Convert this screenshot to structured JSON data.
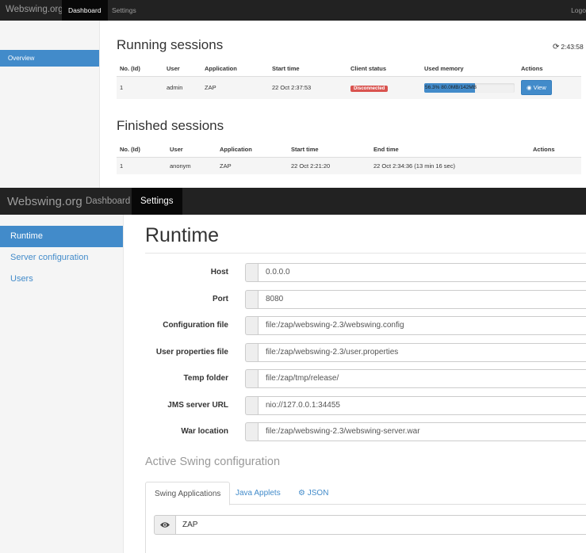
{
  "dashboard": {
    "brand": "Webswing.org",
    "nav": {
      "dashboard": "Dashboard",
      "settings": "Settings",
      "logout": "Logo"
    },
    "sidebar": {
      "overview": "Overview"
    },
    "clock": "2:43:58",
    "running": {
      "title": "Running sessions",
      "headers": [
        "No. (Id)",
        "User",
        "Application",
        "Start time",
        "Client status",
        "Used memory",
        "Actions"
      ],
      "rows": [
        {
          "id": "1",
          "user": "admin",
          "application": "ZAP",
          "start_time": "22 Oct 2:37:53",
          "client_status": "Disconnected",
          "memory_text": "56.3% 80.0MB/142MB",
          "memory_percent": 56.3,
          "action": "View"
        }
      ]
    },
    "finished": {
      "title": "Finished sessions",
      "headers": [
        "No. (Id)",
        "User",
        "Application",
        "Start time",
        "End time",
        "Actions"
      ],
      "rows": [
        {
          "id": "1",
          "user": "anonym",
          "application": "ZAP",
          "start_time": "22 Oct 2:21:20",
          "end_time": "22 Oct 2:34:36 (13 min 16 sec)"
        }
      ]
    }
  },
  "settings": {
    "brand": "Webswing.org",
    "nav": {
      "dashboard": "Dashboard",
      "settings": "Settings"
    },
    "sidebar": [
      "Runtime",
      "Server configuration",
      "Users"
    ],
    "title": "Runtime",
    "fields": [
      {
        "label": "Host",
        "value": "0.0.0.0"
      },
      {
        "label": "Port",
        "value": "8080"
      },
      {
        "label": "Configuration file",
        "value": "file:/zap/webswing-2.3/webswing.config"
      },
      {
        "label": "User properties file",
        "value": "file:/zap/webswing-2.3/user.properties"
      },
      {
        "label": "Temp folder",
        "value": "file:/zap/tmp/release/"
      },
      {
        "label": "JMS server URL",
        "value": "nio://127.0.0.1:34455"
      },
      {
        "label": "War location",
        "value": "file:/zap/webswing-2.3/webswing-server.war"
      }
    ],
    "swing_title": "Active Swing configuration",
    "tabs": [
      "Swing Applications",
      "Java Applets",
      "JSON"
    ],
    "apps": [
      {
        "name": "ZAP"
      }
    ]
  },
  "colors": {
    "primary": "#428bca",
    "danger": "#d9534f",
    "navbar": "#222222"
  },
  "icons": {
    "clock": "refresh-icon",
    "view": "camera-icon",
    "json": "gear-icon",
    "app": "eye-icon"
  }
}
